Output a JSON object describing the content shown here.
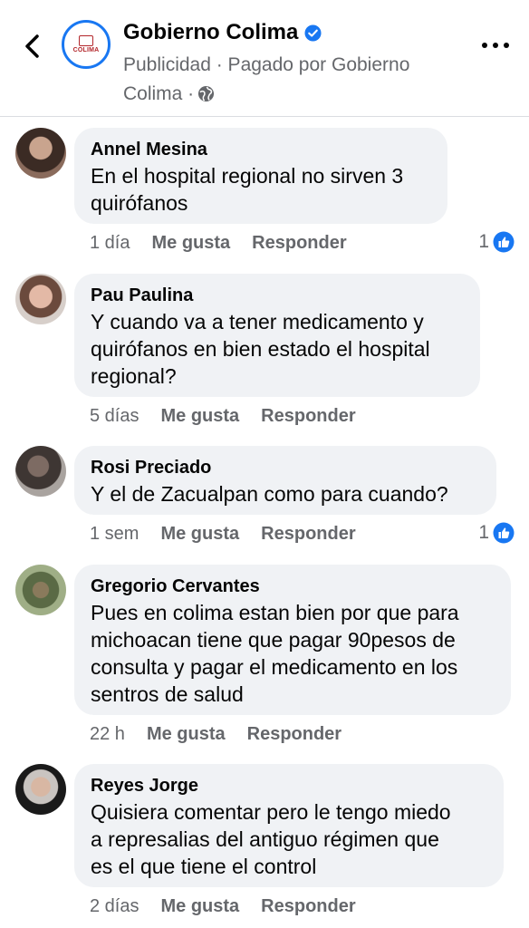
{
  "header": {
    "page_name": "Gobierno Colima",
    "subtitle_line1": "Publicidad · Pagado por Gobierno",
    "subtitle_line2": "Colima ·",
    "logo_text": "COLIMA"
  },
  "comments": [
    {
      "author": "Annel Mesina",
      "text_lines": [
        "En el hospital regional no sirven 3",
        "quirófanos"
      ],
      "time": "1 día",
      "like_label": "Me gusta",
      "reply_label": "Responder",
      "reaction_count": "1"
    },
    {
      "author": "Pau Paulina",
      "text_lines": [
        "Y cuando va a tener medicamento y",
        "quirófanos en bien estado el hospital",
        "regional?"
      ],
      "time": "5 días",
      "like_label": "Me gusta",
      "reply_label": "Responder"
    },
    {
      "author": "Rosi Preciado",
      "text_lines": [
        "Y el de Zacualpan como para cuando?"
      ],
      "time": "1 sem",
      "like_label": "Me gusta",
      "reply_label": "Responder",
      "reaction_count": "1"
    },
    {
      "author": "Gregorio Cervantes",
      "text_lines": [
        "Pues en colima estan bien por que para",
        "michoacan tiene que pagar 90pesos de",
        "consulta y pagar el medicamento en los",
        "sentros de salud"
      ],
      "time": "22 h",
      "like_label": "Me gusta",
      "reply_label": "Responder"
    },
    {
      "author": "Reyes Jorge",
      "text_lines": [
        "Quisiera comentar pero le tengo miedo",
        "a represalias del antiguo régimen que",
        "es el que tiene el control"
      ],
      "time": "2 días",
      "like_label": "Me gusta",
      "reply_label": "Responder"
    }
  ],
  "colors": {
    "accent": "#1877f2",
    "bubble": "#f0f2f5",
    "muted": "#65676b"
  }
}
